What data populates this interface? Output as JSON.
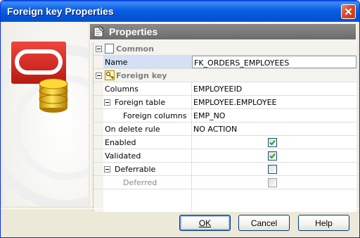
{
  "window": {
    "title": "Foreign key Properties"
  },
  "header": {
    "title": "Properties"
  },
  "categories": {
    "common": "Common",
    "foreign_key": "Foreign key"
  },
  "rows": {
    "name": {
      "label": "Name",
      "value": "FK_ORDERS_EMPLOYEES"
    },
    "columns": {
      "label": "Columns",
      "value": "EMPLOYEEID"
    },
    "foreign_table": {
      "label": "Foreign table",
      "value": "EMPLOYEE.EMPLOYEE"
    },
    "foreign_columns": {
      "label": "Foreign columns",
      "value": "EMP_NO"
    },
    "on_delete_rule": {
      "label": "On delete rule",
      "value": "NO ACTION"
    },
    "enabled": {
      "label": "Enabled",
      "checked": true
    },
    "validated": {
      "label": "Validated",
      "checked": true
    },
    "deferrable": {
      "label": "Deferrable",
      "checked": false
    },
    "deferred": {
      "label": "Deferred",
      "checked": false
    }
  },
  "buttons": {
    "ok": "OK",
    "cancel": "Cancel",
    "help": "Help"
  },
  "icons": {
    "close": "close-icon",
    "logo": "oracle-database-icon",
    "properties": "properties-icon",
    "common_category": "blank-page-icon",
    "foreign_key_category": "key-icon"
  },
  "colors": {
    "title_bar": "#0454d6",
    "oracle_red": "#e2231a",
    "database_gold": "#e0b000",
    "checkbox_check": "#21a121"
  }
}
